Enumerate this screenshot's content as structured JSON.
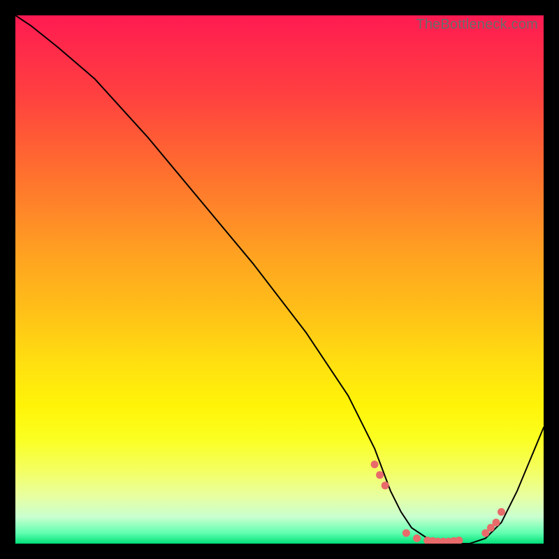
{
  "watermark": "TheBottleneck.com",
  "chart_data": {
    "type": "line",
    "title": "",
    "xlabel": "",
    "ylabel": "",
    "xlim": [
      0,
      100
    ],
    "ylim": [
      0,
      100
    ],
    "series": [
      {
        "name": "bottleneck-curve",
        "x": [
          0,
          3,
          8,
          15,
          25,
          35,
          45,
          55,
          63,
          68,
          71,
          73,
          75,
          78,
          82,
          86,
          89,
          92,
          95,
          100
        ],
        "y": [
          100,
          98,
          94,
          88,
          77,
          65,
          53,
          40,
          28,
          18,
          10,
          6,
          3,
          1,
          0,
          0,
          1,
          4,
          10,
          22
        ]
      }
    ],
    "markers": {
      "name": "highlight-dots",
      "x": [
        68,
        69,
        70,
        74,
        76,
        78,
        79,
        80,
        81,
        82,
        83,
        84,
        89,
        90,
        91,
        92
      ],
      "y": [
        15,
        13,
        11,
        2,
        1,
        0.6,
        0.5,
        0.4,
        0.4,
        0.4,
        0.5,
        0.6,
        2,
        3,
        4,
        6
      ]
    },
    "colors": {
      "gradient_top": "#ff1a52",
      "gradient_mid": "#ffe010",
      "gradient_bottom": "#00e078",
      "curve": "#000000",
      "dots": "#e86a6a",
      "frame": "#000000",
      "watermark": "#6b6b6b"
    }
  }
}
